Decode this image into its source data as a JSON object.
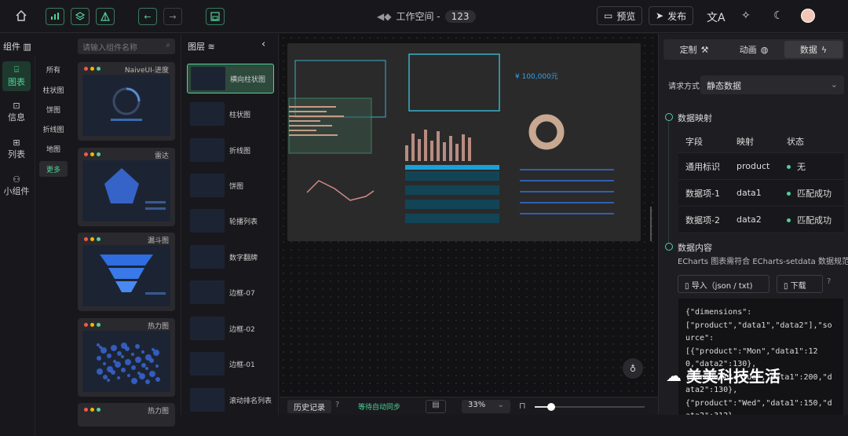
{
  "header": {
    "workspace_label": "工作空间 -",
    "workspace_id": "123",
    "preview": "预览",
    "publish": "发布"
  },
  "rail": [
    {
      "label": "图表",
      "active": true
    },
    {
      "label": "信息"
    },
    {
      "label": "列表"
    },
    {
      "label": "小组件"
    }
  ],
  "panel_title": "组件",
  "categories": [
    {
      "label": "所有"
    },
    {
      "label": "柱状图"
    },
    {
      "label": "饼图"
    },
    {
      "label": "折线图"
    },
    {
      "label": "地图"
    },
    {
      "label": "更多",
      "active": true
    }
  ],
  "search_placeholder": "请输入组件名称",
  "components": [
    {
      "name": "NaiveUI-进度"
    },
    {
      "name": "雷达"
    },
    {
      "name": "漏斗图"
    },
    {
      "name": "热力图"
    },
    {
      "name": "热力图"
    }
  ],
  "layers_title": "图层",
  "layers": [
    {
      "label": "横向柱状图",
      "active": true
    },
    {
      "label": "柱状图"
    },
    {
      "label": "折线图"
    },
    {
      "label": "饼图"
    },
    {
      "label": "轮播列表"
    },
    {
      "label": "数字翻牌"
    },
    {
      "label": "边框-07"
    },
    {
      "label": "边框-02"
    },
    {
      "label": "边框-01"
    },
    {
      "label": "滚动排名列表"
    }
  ],
  "stage": {
    "money": "¥ 100,000元"
  },
  "bottom": {
    "history": "历史记录",
    "autosave": "等待自动同步",
    "zoom": "33%"
  },
  "right": {
    "tabs": [
      {
        "label": "定制"
      },
      {
        "label": "动画"
      },
      {
        "label": "数据",
        "active": true
      }
    ],
    "request_label": "请求方式",
    "request_value": "静态数据",
    "mapping_title": "数据映射",
    "table_headers": [
      "字段",
      "映射",
      "状态"
    ],
    "table_rows": [
      {
        "field": "通用标识",
        "map": "product",
        "status": "无"
      },
      {
        "field": "数据项-1",
        "map": "data1",
        "status": "匹配成功"
      },
      {
        "field": "数据项-2",
        "map": "data2",
        "status": "匹配成功"
      }
    ],
    "content_title": "数据内容",
    "content_desc": "ECharts 图表需符合 ECharts-setdata 数据规范",
    "import_btn": "导入（json / txt)",
    "download_btn": "下载",
    "code": "{\"dimensions\":\n[\"product\",\"data1\",\"data2\"],\"source\":\n[{\"product\":\"Mon\",\"data1\":120,\"data2\":130},\n{\"product\":\"Tue\",\"data1\":200,\"data2\":130},\n{\"product\":\"Wed\",\"data1\":150,\"data2\":312},"
  },
  "watermark": "美美科技生活",
  "colors": {
    "accent": "#4fd19a"
  }
}
